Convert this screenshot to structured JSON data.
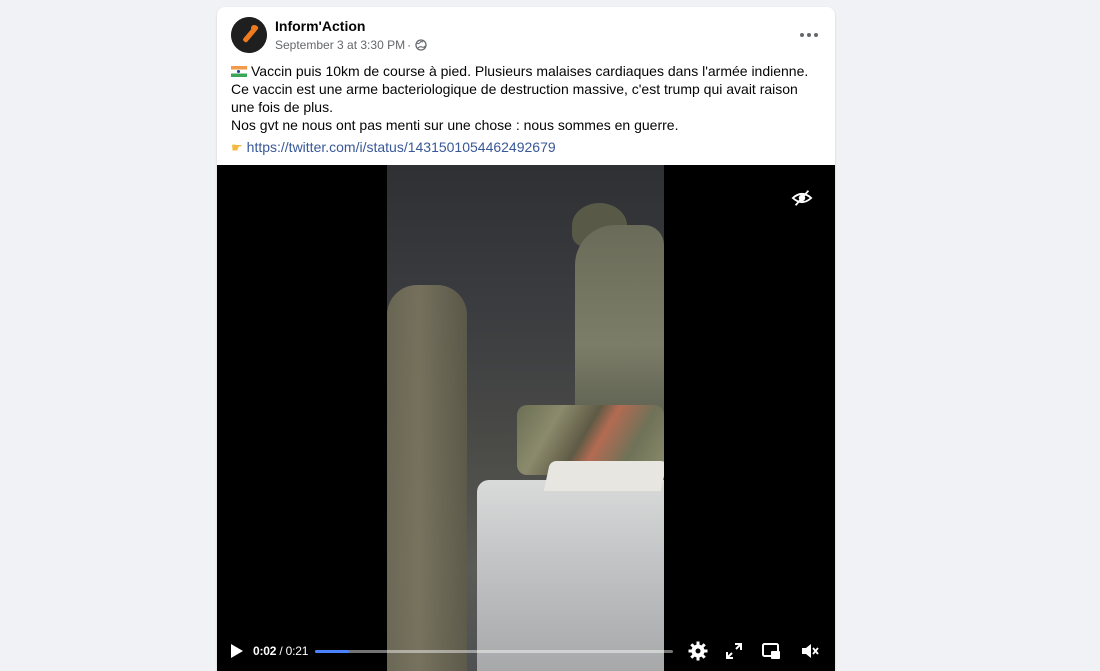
{
  "post": {
    "author": "Inform'Action",
    "timestamp": "September 3 at 3:30 PM",
    "separator": "·",
    "privacy_icon": "globe-icon",
    "more_icon": "more-options-icon",
    "lines": [
      "Vaccin puis 10km de course à pied. Plusieurs malaises cardiaques dans l'armée indienne.",
      "Ce vaccin est une arme bacteriologique de destruction massive, c'est trump qui avait raison une fois de plus.",
      "Nos gvt ne nous ont pas menti sur une chose : nous sommes en guerre."
    ],
    "flag_icon": "india-flag-icon",
    "link_prefix_icon": "pointing-hand-icon",
    "link": "https://twitter.com/i/status/1431501054462492679"
  },
  "video": {
    "current_time": "0:02",
    "duration": "0:21",
    "time_separator": "/",
    "progress_fraction": 0.095,
    "accent_color": "#4a83ff",
    "icons": [
      "play-icon",
      "settings-icon",
      "fullscreen-icon",
      "picture-in-picture-icon",
      "mute-icon",
      "hide-eye-icon"
    ]
  }
}
